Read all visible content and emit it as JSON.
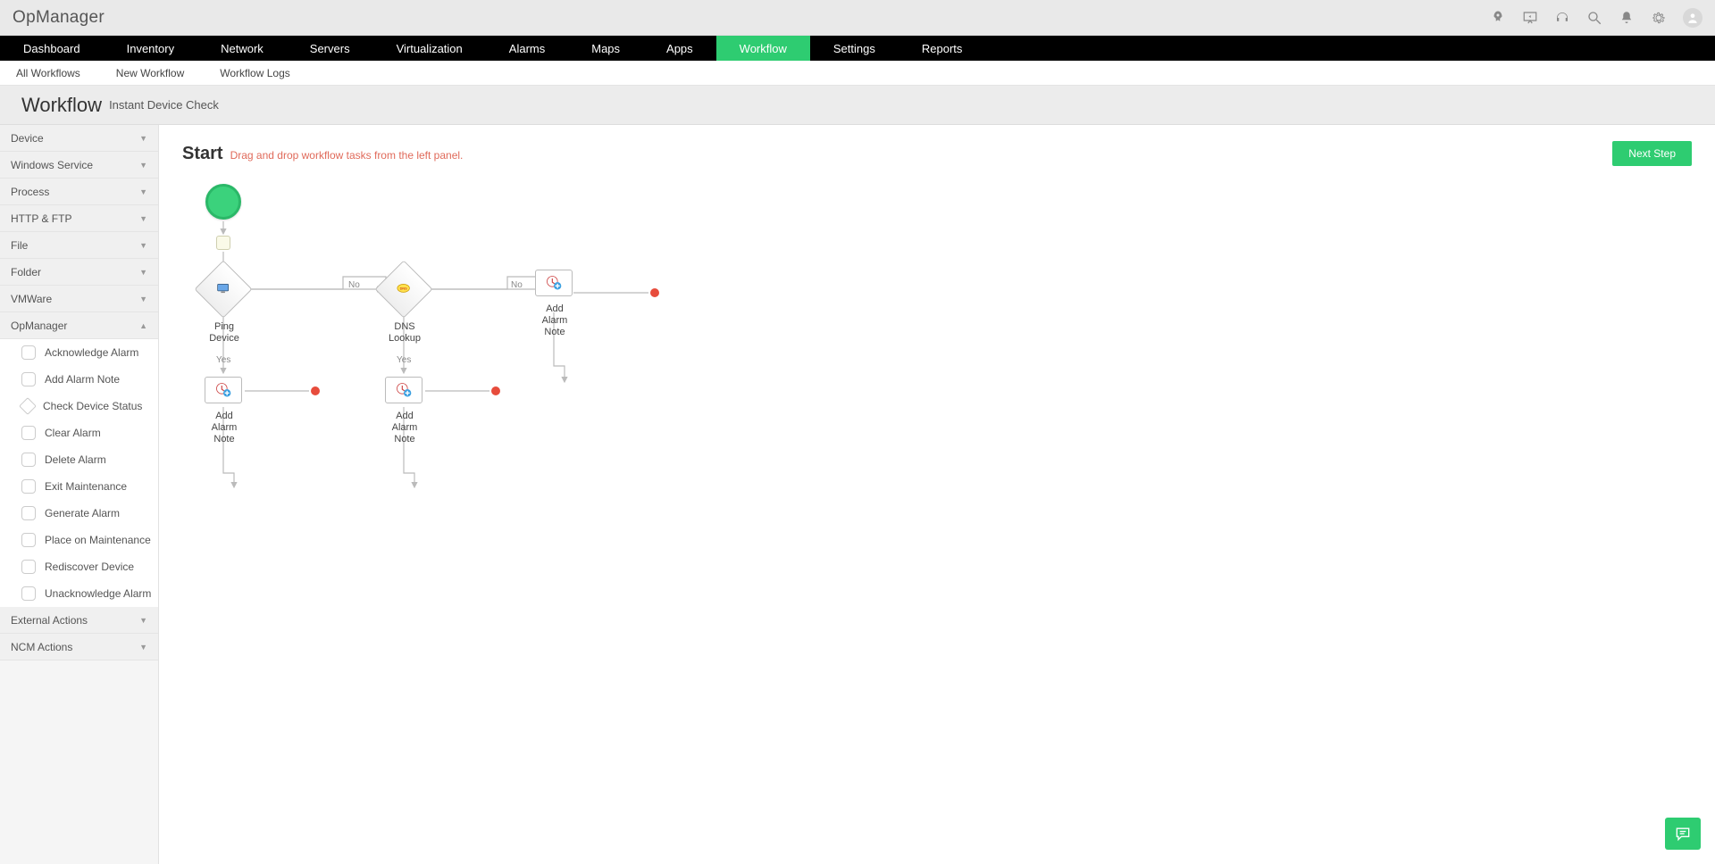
{
  "brand": "OpManager",
  "mainnav": [
    "Dashboard",
    "Inventory",
    "Network",
    "Servers",
    "Virtualization",
    "Alarms",
    "Maps",
    "Apps",
    "Workflow",
    "Settings",
    "Reports"
  ],
  "mainnav_active": "Workflow",
  "subnav": [
    "All Workflows",
    "New Workflow",
    "Workflow Logs"
  ],
  "page_title": "Workflow",
  "page_subtitle": "Instant Device Check",
  "start_label": "Start",
  "start_hint": "Drag and drop workflow tasks from the left panel.",
  "next_btn": "Next Step",
  "sidebar": {
    "groups": [
      {
        "label": "Device",
        "open": false
      },
      {
        "label": "Windows Service",
        "open": false
      },
      {
        "label": "Process",
        "open": false
      },
      {
        "label": "HTTP & FTP",
        "open": false
      },
      {
        "label": "File",
        "open": false
      },
      {
        "label": "Folder",
        "open": false
      },
      {
        "label": "VMWare",
        "open": false
      },
      {
        "label": "OpManager",
        "open": true,
        "tasks": [
          "Acknowledge Alarm",
          "Add Alarm Note",
          "Check Device Status",
          "Clear Alarm",
          "Delete Alarm",
          "Exit Maintenance",
          "Generate Alarm",
          "Place on Maintenance",
          "Rediscover Device",
          "Unacknowledge Alarm"
        ]
      },
      {
        "label": "External Actions",
        "open": false
      },
      {
        "label": "NCM Actions",
        "open": false
      }
    ]
  },
  "flow": {
    "ping_label": "Ping\nDevice",
    "dns_label": "DNS\nLookup",
    "add_note": "Add\nAlarm\nNote",
    "yes": "Yes",
    "no": "No"
  }
}
